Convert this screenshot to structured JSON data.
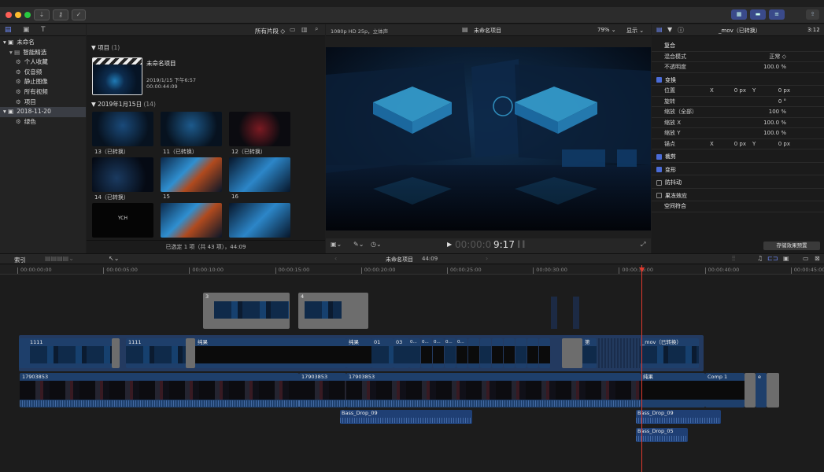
{
  "window": {
    "title": "未命名项目"
  },
  "colors": {
    "accent": "#4a6bd6",
    "playhead": "#e03a2e",
    "clip_blue": "#1e4a80",
    "audio_blue": "#2a4d86"
  },
  "library": {
    "icons": [
      "library-icon",
      "photos-icon",
      "titles-icon"
    ],
    "items": [
      {
        "label": "未命名",
        "level": 0
      },
      {
        "label": "智能精选",
        "level": 1
      },
      {
        "label": "个人收藏",
        "level": 2
      },
      {
        "label": "仅音频",
        "level": 2
      },
      {
        "label": "静止图像",
        "level": 2
      },
      {
        "label": "所有视频",
        "level": 2
      },
      {
        "label": "项目",
        "level": 2
      },
      {
        "label": "2018-11-20",
        "level": 0,
        "selected": true
      },
      {
        "label": "绿色",
        "level": 2
      }
    ]
  },
  "browser": {
    "filter": "所有片段 ◇",
    "section_project": "项目",
    "section_project_count": "(1)",
    "project_name": "未命名项目",
    "project_date": "2019/1/15 下午6:57",
    "project_duration": "00:00:44:09",
    "section_date": "2019年1月15日",
    "section_date_count": "(14)",
    "clips": [
      {
        "label": "13（已转换）"
      },
      {
        "label": "11（已转换）"
      },
      {
        "label": "12（已转换）"
      },
      {
        "label": "14（已转换）"
      },
      {
        "label": "15"
      },
      {
        "label": "16"
      },
      {
        "label": ""
      },
      {
        "label": ""
      },
      {
        "label": ""
      }
    ],
    "clip_text_overlay": "YCH",
    "status": "已选定 1 项（共 43 项），44:09"
  },
  "viewer": {
    "format": "1080p HD 25p，立体声",
    "project": "未命名项目",
    "zoom": "79%",
    "display": "显示",
    "timecode": "00:00:09:17",
    "timecode_dim": "00:00:0",
    "timecode_bright": "9:17"
  },
  "inspector": {
    "clip": "_mov（已转换）",
    "duration": "3:12",
    "sections": [
      {
        "label": "复合",
        "type": "header"
      },
      {
        "label": "混合模式",
        "value": "正常 ◇",
        "type": "row"
      },
      {
        "label": "不透明度",
        "value": "100.0  %",
        "type": "row"
      },
      {
        "label": "变换",
        "type": "check",
        "checked": true
      },
      {
        "label": "位置",
        "x_label": "X",
        "x": "0 px",
        "y_label": "Y",
        "y": "0 px",
        "type": "xy"
      },
      {
        "label": "旋转",
        "value": "0 °",
        "type": "row"
      },
      {
        "label": "缩放（全部）",
        "value": "100 %",
        "type": "row"
      },
      {
        "label": "缩放 X",
        "value": "100.0 %",
        "type": "row"
      },
      {
        "label": "缩放 Y",
        "value": "100.0 %",
        "type": "row"
      },
      {
        "label": "锚点",
        "x_label": "X",
        "x": "0 px",
        "y_label": "Y",
        "y": "0 px",
        "type": "xy"
      },
      {
        "label": "裁剪",
        "type": "check",
        "checked": true
      },
      {
        "label": "变形",
        "type": "check",
        "checked": true
      },
      {
        "label": "防抖动",
        "type": "check",
        "checked": false
      },
      {
        "label": "果冻效应",
        "type": "check",
        "checked": false
      },
      {
        "label": "空间符合",
        "type": "plain"
      }
    ],
    "save_preset": "存储效果预置"
  },
  "timeline": {
    "index": "索引",
    "project": "未命名项目",
    "duration": "44:09",
    "ruler": [
      "00:00:00:00",
      "00:00:05:00",
      "00:00:10:00",
      "00:00:15:00",
      "00:00:20:00",
      "00:00:25:00",
      "00:00:30:00",
      "00:00:35:00",
      "00:00:40:00",
      "00:00:45:00"
    ],
    "playhead_time_fraction": 0.803,
    "connected_top": [
      {
        "label": "3"
      },
      {
        "label": "4"
      }
    ],
    "upper_clips": [
      {
        "label": "1111"
      },
      {
        "label": "1111"
      },
      {
        "label": "纯果"
      },
      {
        "label": "纯果"
      },
      {
        "label": "01"
      },
      {
        "label": "03"
      },
      {
        "label": "第"
      },
      {
        "label": "_mov（已转换）"
      }
    ],
    "primary": [
      {
        "label": "17903853"
      },
      {
        "label": "17903853"
      },
      {
        "label": "17903853"
      },
      {
        "label": "纯果"
      },
      {
        "label": "Comp 1"
      },
      {
        "label": "e"
      }
    ],
    "audio": [
      {
        "label": "Bass_Drop_09"
      },
      {
        "label": "Bass_Drop_09"
      },
      {
        "label": "Bass_Drop_05"
      }
    ],
    "small_labels": [
      "0...",
      "0...",
      "0...",
      "0...",
      "0..."
    ]
  }
}
